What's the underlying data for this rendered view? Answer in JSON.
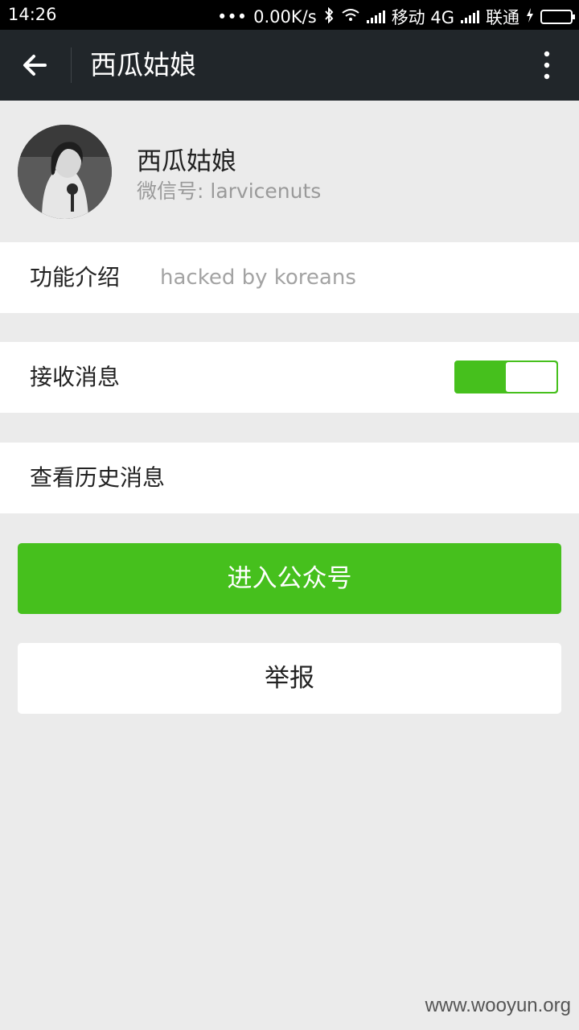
{
  "status_bar": {
    "time": "14:26",
    "dots": "•••",
    "net_speed": "0.00K/s",
    "bluetooth": "bluetooth-icon",
    "wifi": "wifi-icon",
    "carrier1": "移动 4G",
    "carrier2": "联通"
  },
  "app_bar": {
    "title": "西瓜姑娘"
  },
  "profile": {
    "name": "西瓜姑娘",
    "wechat_id": "微信号: larvicenuts"
  },
  "rows": {
    "intro_label": "功能介绍",
    "intro_value": "hacked by koreans",
    "receive_label": "接收消息",
    "receive_on": true,
    "history_label": "查看历史消息"
  },
  "buttons": {
    "enter": "进入公众号",
    "report": "举报"
  },
  "watermark": "www.wooyun.org",
  "colors": {
    "accent": "#46c01d",
    "appbar": "#21262a",
    "background": "#ebebeb"
  }
}
